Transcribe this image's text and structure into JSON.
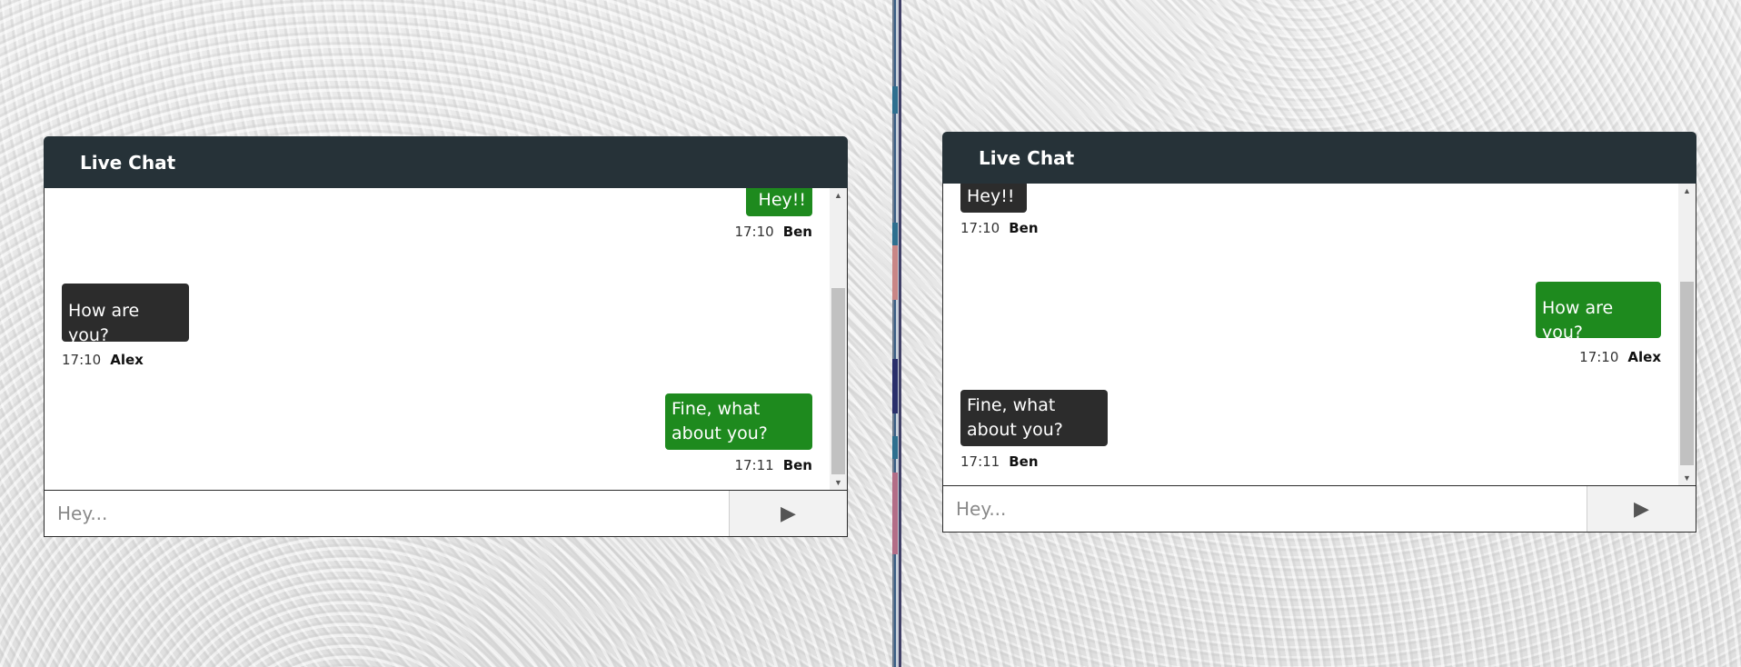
{
  "chat_left": {
    "title": "Live Chat",
    "input_placeholder": "Hey...",
    "send_icon": "▶",
    "messages": [
      {
        "text": "Hey!!",
        "time": "17:10",
        "author": "Ben"
      },
      {
        "text": "How are you?",
        "time": "17:10",
        "author": "Alex"
      },
      {
        "text": "Fine, what about you?",
        "time": "17:11",
        "author": "Ben"
      }
    ]
  },
  "chat_right": {
    "title": "Live Chat",
    "input_placeholder": "Hey...",
    "send_icon": "▶",
    "messages": [
      {
        "text": "Hey!!",
        "time": "17:10",
        "author": "Ben"
      },
      {
        "text": "How are you?",
        "time": "17:10",
        "author": "Alex"
      },
      {
        "text": "Fine, what about you?",
        "time": "17:11",
        "author": "Ben"
      }
    ]
  },
  "colors": {
    "header": "#263238",
    "bubble_green": "#1e8a1e",
    "bubble_dark": "#2c2c2c"
  }
}
